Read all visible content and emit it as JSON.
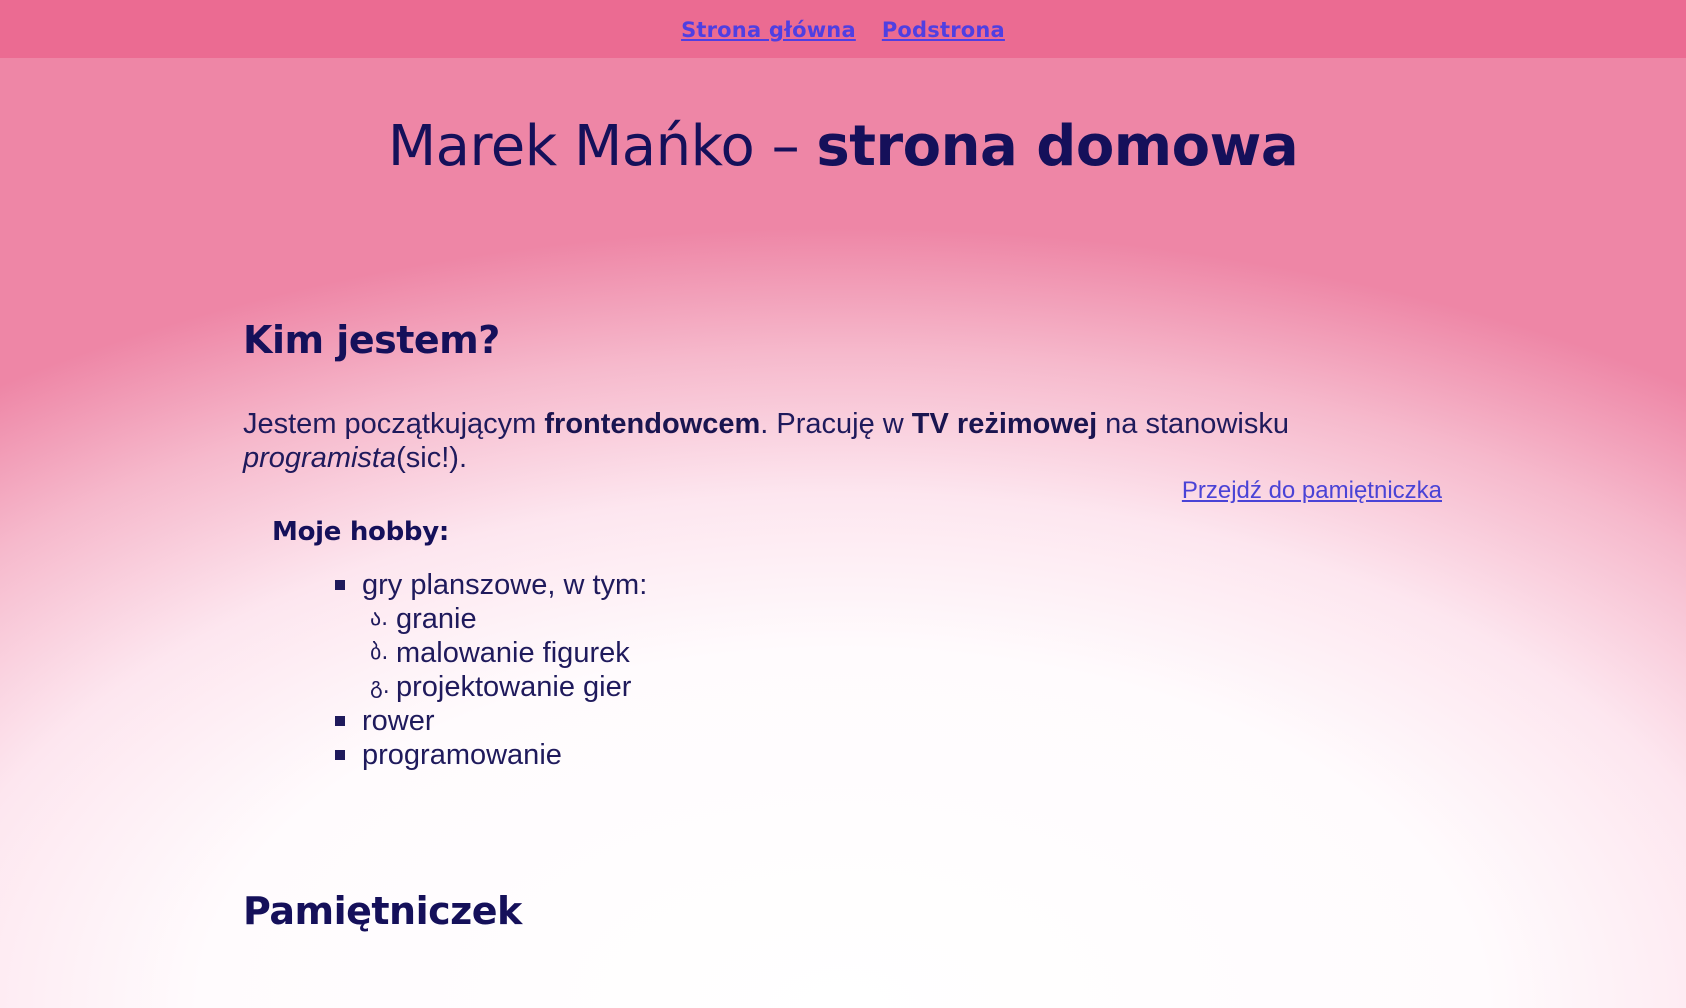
{
  "nav": {
    "home": "Strona główna",
    "subpage": "Podstrona"
  },
  "title": {
    "part1": "Marek Mańko – ",
    "part2": "strona domowa"
  },
  "about": {
    "heading": "Kim jestem?",
    "t1": "Jestem początkującym ",
    "b1": "frontendowcem",
    "t2": ". Pracuję w ",
    "b2": "TV reżimowej",
    "t3": " na stanowisku ",
    "i1": "programista",
    "t4": "(sic!).",
    "diary_link": "Przejdź do pamiętniczka"
  },
  "hobbies": {
    "heading": "Moje hobby:",
    "items": [
      {
        "label": "gry planszowe, w tym:"
      },
      {
        "label": "rower"
      },
      {
        "label": "programowanie"
      }
    ],
    "sub_items": [
      {
        "marker": "ა.",
        "label": "granie"
      },
      {
        "marker": "ბ.",
        "label": "malowanie figurek"
      },
      {
        "marker": "გ.",
        "label": "projektowanie gier"
      }
    ]
  },
  "diary": {
    "heading": "Pamiętniczek"
  }
}
